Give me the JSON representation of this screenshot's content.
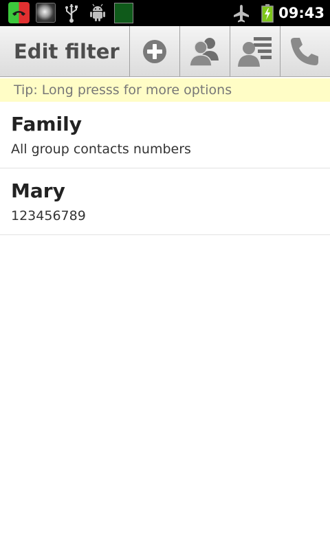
{
  "status_bar": {
    "time": "09:43",
    "icons": [
      "call-filter-app-icon",
      "photo-app-icon",
      "usb-icon",
      "android-debug-icon",
      "green-app-icon",
      "airplane-mode-icon",
      "battery-charging-icon"
    ]
  },
  "action_bar": {
    "title": "Edit filter",
    "buttons": [
      "add-icon",
      "group-icon",
      "contact-list-icon",
      "phone-icon"
    ]
  },
  "tip": {
    "text": "Tip: Long presss for more options"
  },
  "list": {
    "items": [
      {
        "title": "Family",
        "subtitle": "All group contacts numbers"
      },
      {
        "title": "Mary",
        "subtitle": "123456789"
      }
    ]
  },
  "colors": {
    "status_bar": "#000000",
    "action_bar": "#e8e8e8",
    "tip_background": "#fffdc6",
    "icon_gray": "#7a7a7a"
  }
}
